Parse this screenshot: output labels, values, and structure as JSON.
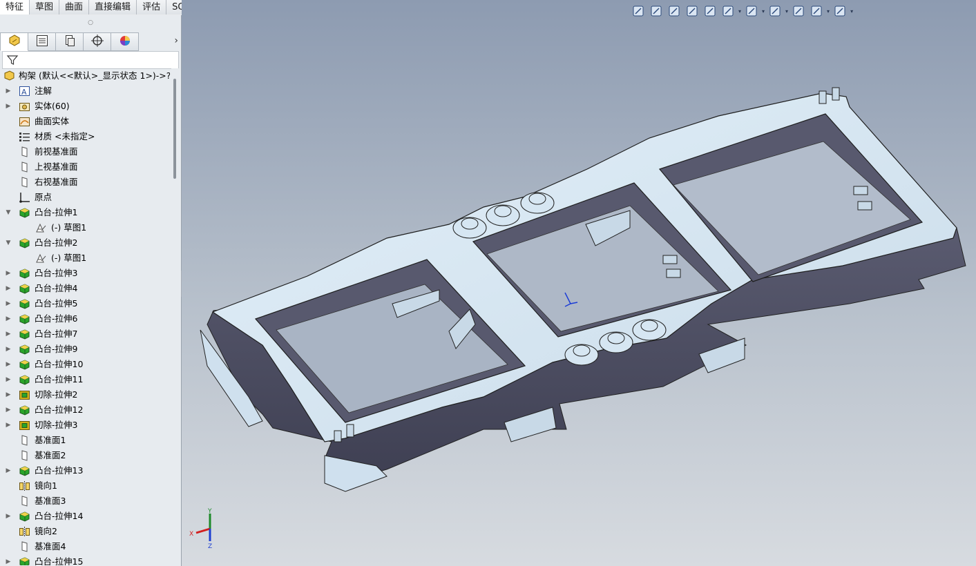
{
  "command_tabs": [
    {
      "label": "特征",
      "active": true
    },
    {
      "label": "草图",
      "active": false
    },
    {
      "label": "曲面",
      "active": false
    },
    {
      "label": "直接编辑",
      "active": false
    },
    {
      "label": "评估",
      "active": false
    },
    {
      "label": "SOLIDWORKS 插件",
      "active": false
    }
  ],
  "panel": {
    "grip": "○",
    "tabs": [
      {
        "icon": "feature-manager-icon"
      },
      {
        "icon": "property-manager-icon"
      },
      {
        "icon": "configuration-manager-icon"
      },
      {
        "icon": "dimxpert-manager-icon"
      },
      {
        "icon": "display-manager-icon"
      }
    ],
    "more": "›",
    "collapse_glyph": "‹"
  },
  "tree": {
    "root": {
      "label": "构架  (默认<<默认>_显示状态 1>)->?",
      "icon": "part-icon"
    },
    "items": [
      {
        "label": "注解",
        "icon": "annotations-icon",
        "expander": "▶",
        "indent": 0
      },
      {
        "label": "实体(60)",
        "icon": "solid-bodies-icon",
        "expander": "▶",
        "indent": 0
      },
      {
        "label": "曲面实体",
        "icon": "surface-bodies-icon",
        "expander": "",
        "indent": 0
      },
      {
        "label": "材质 <未指定>",
        "icon": "material-icon",
        "expander": "",
        "indent": 0
      },
      {
        "label": "前视基准面",
        "icon": "plane-icon",
        "expander": "",
        "indent": 0
      },
      {
        "label": "上视基准面",
        "icon": "plane-icon",
        "expander": "",
        "indent": 0
      },
      {
        "label": "右视基准面",
        "icon": "plane-icon",
        "expander": "",
        "indent": 0
      },
      {
        "label": "原点",
        "icon": "origin-icon",
        "expander": "",
        "indent": 0
      },
      {
        "label": "凸台-拉伸1",
        "icon": "boss-extrude-icon",
        "expander": "▼",
        "indent": 0
      },
      {
        "label": "(-) 草图1",
        "icon": "sketch-icon",
        "expander": "",
        "indent": 1
      },
      {
        "label": "凸台-拉伸2",
        "icon": "boss-extrude-icon",
        "expander": "▼",
        "indent": 0
      },
      {
        "label": "(-) 草图1",
        "icon": "sketch-icon",
        "expander": "",
        "indent": 1
      },
      {
        "label": "凸台-拉伸3",
        "icon": "boss-extrude-icon",
        "expander": "▶",
        "indent": 0
      },
      {
        "label": "凸台-拉伸4",
        "icon": "boss-extrude-icon",
        "expander": "▶",
        "indent": 0
      },
      {
        "label": "凸台-拉伸5",
        "icon": "boss-extrude-icon",
        "expander": "▶",
        "indent": 0
      },
      {
        "label": "凸台-拉伸6",
        "icon": "boss-extrude-icon",
        "expander": "▶",
        "indent": 0
      },
      {
        "label": "凸台-拉伸7",
        "icon": "boss-extrude-icon",
        "expander": "▶",
        "indent": 0
      },
      {
        "label": "凸台-拉伸9",
        "icon": "boss-extrude-icon",
        "expander": "▶",
        "indent": 0
      },
      {
        "label": "凸台-拉伸10",
        "icon": "boss-extrude-icon",
        "expander": "▶",
        "indent": 0
      },
      {
        "label": "凸台-拉伸11",
        "icon": "boss-extrude-icon",
        "expander": "▶",
        "indent": 0
      },
      {
        "label": "切除-拉伸2",
        "icon": "cut-extrude-icon",
        "expander": "▶",
        "indent": 0
      },
      {
        "label": "凸台-拉伸12",
        "icon": "boss-extrude-icon",
        "expander": "▶",
        "indent": 0
      },
      {
        "label": "切除-拉伸3",
        "icon": "cut-extrude-icon",
        "expander": "▶",
        "indent": 0
      },
      {
        "label": "基准面1",
        "icon": "plane-icon",
        "expander": "",
        "indent": 0
      },
      {
        "label": "基准面2",
        "icon": "plane-icon",
        "expander": "",
        "indent": 0
      },
      {
        "label": "凸台-拉伸13",
        "icon": "boss-extrude-icon",
        "expander": "▶",
        "indent": 0
      },
      {
        "label": "镜向1",
        "icon": "mirror-icon",
        "expander": "",
        "indent": 0
      },
      {
        "label": "基准面3",
        "icon": "plane-icon",
        "expander": "",
        "indent": 0
      },
      {
        "label": "凸台-拉伸14",
        "icon": "boss-extrude-icon",
        "expander": "▶",
        "indent": 0
      },
      {
        "label": "镜向2",
        "icon": "mirror-icon",
        "expander": "",
        "indent": 0
      },
      {
        "label": "基准面4",
        "icon": "plane-icon",
        "expander": "",
        "indent": 0
      },
      {
        "label": "凸台-拉伸15",
        "icon": "boss-extrude-icon",
        "expander": "▶",
        "indent": 0
      }
    ]
  },
  "heads_up_toolbar": [
    {
      "icon": "zoom-to-fit-icon"
    },
    {
      "icon": "zoom-to-area-icon"
    },
    {
      "icon": "previous-view-icon"
    },
    {
      "icon": "section-view-icon"
    },
    {
      "icon": "dynamic-annotation-views-icon"
    },
    {
      "icon": "view-orientation-icon",
      "dropdown": true
    },
    {
      "icon": "display-style-icon",
      "dropdown": true
    },
    {
      "icon": "hide-show-items-icon",
      "dropdown": true
    },
    {
      "icon": "edit-appearance-icon"
    },
    {
      "icon": "apply-scene-icon",
      "dropdown": true
    },
    {
      "icon": "view-settings-icon",
      "dropdown": true
    }
  ],
  "triad": {
    "x": "X",
    "y": "Y",
    "z": "Z"
  },
  "colors": {
    "viewport_top": "#8d9bb1",
    "viewport_bottom": "#d7dbe0",
    "frame_top": "#d8e9f5",
    "frame_side": "#4d4e63",
    "frame_inner": "#6b6c82",
    "boss_green": "#2aa52a",
    "cut_yellow": "#d4b21a"
  }
}
